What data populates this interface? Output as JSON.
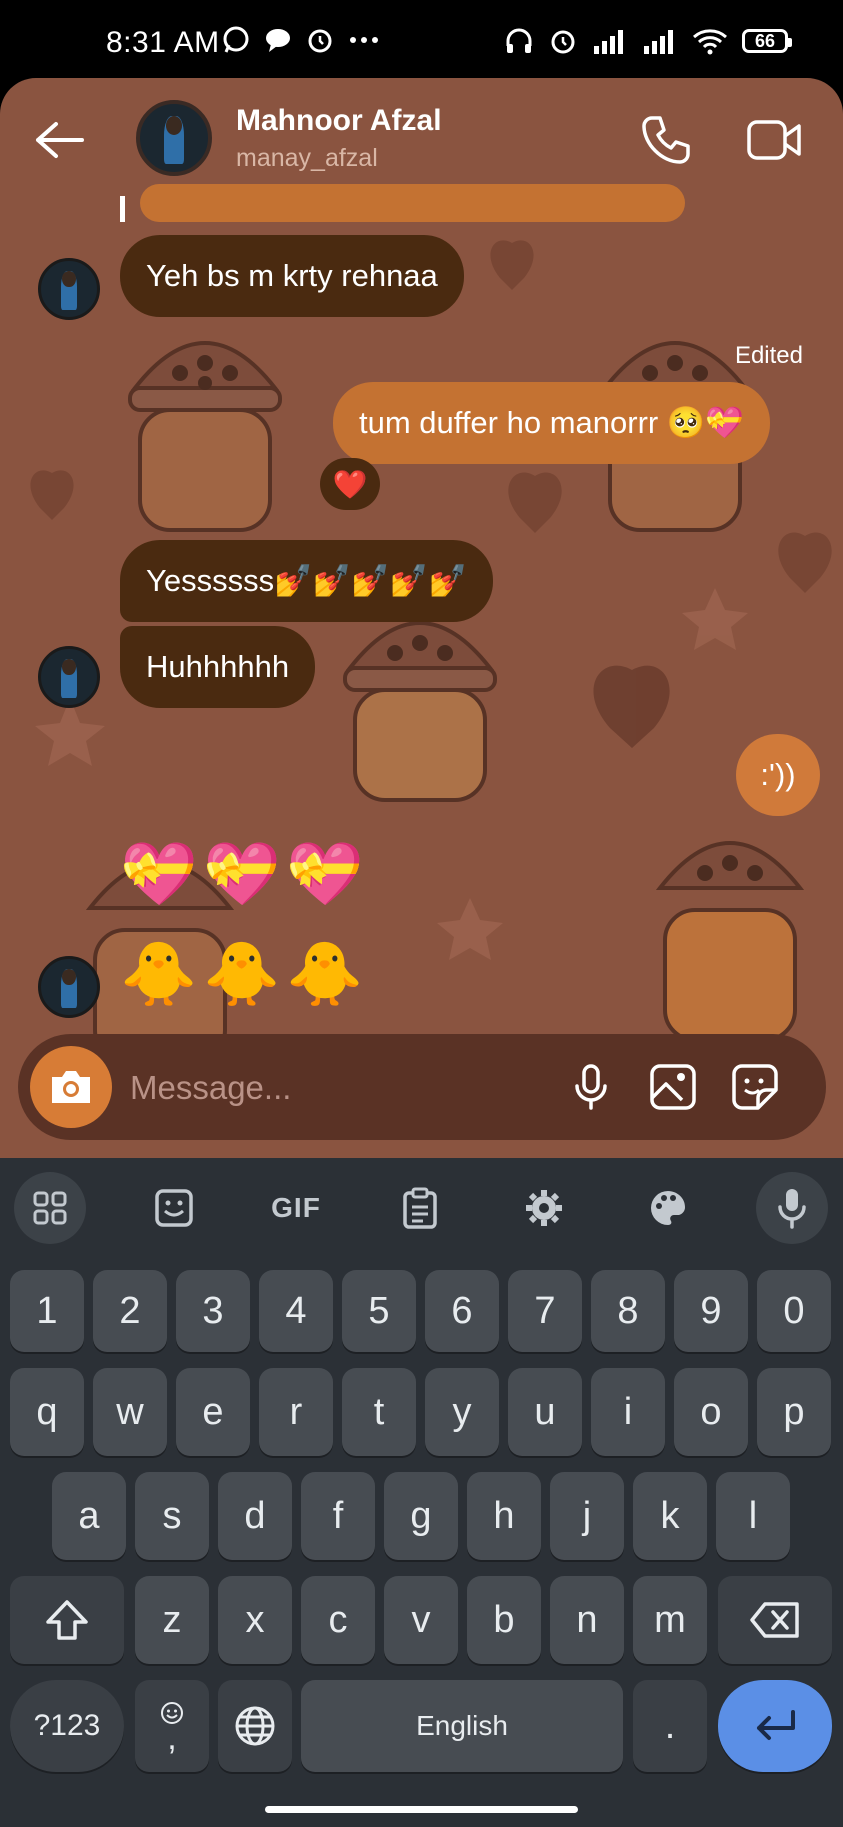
{
  "status_bar": {
    "time": "8:31 AM",
    "battery": "66"
  },
  "header": {
    "contact_name": "Mahnoor Afzal",
    "username": "manay_afzal"
  },
  "messages": {
    "m1": "Yeh bs m krty rehnaa",
    "edited_label": "Edited",
    "m2": "tum duffer  ho manorrr 🥺💝",
    "reaction": "❤️",
    "m3": "Yessssss💅💅💅💅💅",
    "m4": "Huhhhhhh",
    "m5": ":'))",
    "hearts": "💝💝💝",
    "chicks": "🐥🐥🐥"
  },
  "composer": {
    "placeholder": "Message..."
  },
  "keyboard": {
    "numbers": [
      "1",
      "2",
      "3",
      "4",
      "5",
      "6",
      "7",
      "8",
      "9",
      "0"
    ],
    "row1": [
      "q",
      "w",
      "e",
      "r",
      "t",
      "y",
      "u",
      "i",
      "o",
      "p"
    ],
    "row2": [
      "a",
      "s",
      "d",
      "f",
      "g",
      "h",
      "j",
      "k",
      "l"
    ],
    "row3": [
      "z",
      "x",
      "c",
      "v",
      "b",
      "n",
      "m"
    ],
    "symbols_key": "?123",
    "comma_key": ",",
    "space_key": "English",
    "period_key": ".",
    "gif_label": "GIF"
  },
  "colors": {
    "chat_bg": "#8a5440",
    "incoming": "#4a2a10",
    "outgoing": "#c47232",
    "accent": "#5b8fe6"
  }
}
